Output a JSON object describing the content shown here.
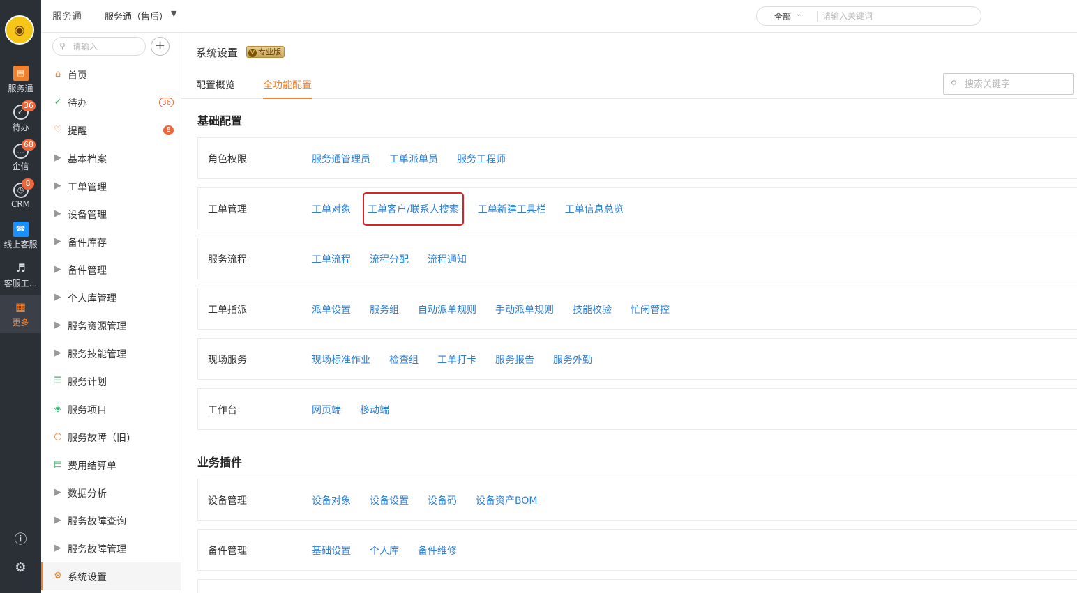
{
  "rail": {
    "items": [
      {
        "label": "服务通",
        "icon": "service-app-icon",
        "badge": ""
      },
      {
        "label": "待办",
        "icon": "check-circle-icon",
        "badge": "36"
      },
      {
        "label": "企信",
        "icon": "chat-bubble-icon",
        "badge": "68"
      },
      {
        "label": "CRM",
        "icon": "clock-icon",
        "badge": "8"
      },
      {
        "label": "线上客服",
        "icon": "headset-icon",
        "badge": ""
      },
      {
        "label": "客服工...",
        "icon": "headphones-icon",
        "badge": ""
      },
      {
        "label": "更多",
        "icon": "grid-icon",
        "badge": ""
      }
    ]
  },
  "topbar": {
    "app_name": "服务通",
    "app_select": "服务通（售后）",
    "search_scope": "全部",
    "search_placeholder": "请输入关键词"
  },
  "sidebar": {
    "search_placeholder": "请输入",
    "items": [
      {
        "label": "首页",
        "icon": "home-icon",
        "badge": ""
      },
      {
        "label": "待办",
        "icon": "check-circle-icon",
        "badge": "36"
      },
      {
        "label": "提醒",
        "icon": "bell-icon",
        "badge": "8"
      },
      {
        "label": "基本档案",
        "icon": "caret-right-icon",
        "badge": ""
      },
      {
        "label": "工单管理",
        "icon": "caret-right-icon",
        "badge": ""
      },
      {
        "label": "设备管理",
        "icon": "caret-right-icon",
        "badge": ""
      },
      {
        "label": "备件库存",
        "icon": "caret-right-icon",
        "badge": ""
      },
      {
        "label": "备件管理",
        "icon": "caret-right-icon",
        "badge": ""
      },
      {
        "label": "个人库管理",
        "icon": "caret-right-icon",
        "badge": ""
      },
      {
        "label": "服务资源管理",
        "icon": "caret-right-icon",
        "badge": ""
      },
      {
        "label": "服务技能管理",
        "icon": "caret-right-icon",
        "badge": ""
      },
      {
        "label": "服务计划",
        "icon": "plan-list-icon",
        "badge": ""
      },
      {
        "label": "服务项目",
        "icon": "layers-icon",
        "badge": ""
      },
      {
        "label": "服务故障（旧)",
        "icon": "bulb-icon",
        "badge": ""
      },
      {
        "label": "费用结算单",
        "icon": "invoice-icon",
        "badge": ""
      },
      {
        "label": "数据分析",
        "icon": "caret-right-icon",
        "badge": ""
      },
      {
        "label": "服务故障查询",
        "icon": "caret-right-icon",
        "badge": ""
      },
      {
        "label": "服务故障管理",
        "icon": "caret-right-icon",
        "badge": ""
      },
      {
        "label": "系统设置",
        "icon": "gear-icon",
        "badge": ""
      }
    ]
  },
  "main": {
    "page_title": "系统设置",
    "pro_badge": "专业版",
    "tabs": [
      {
        "label": "配置概览"
      },
      {
        "label": "全功能配置"
      }
    ],
    "search_placeholder": "搜索关键字",
    "sections": [
      {
        "title": "基础配置",
        "rows": [
          {
            "label": "角色权限",
            "links": [
              "服务通管理员",
              "工单派单员",
              "服务工程师"
            ]
          },
          {
            "label": "工单管理",
            "links": [
              "工单对象",
              "工单客户/联系人搜索",
              "工单新建工具栏",
              "工单信息总览"
            ]
          },
          {
            "label": "服务流程",
            "links": [
              "工单流程",
              "流程分配",
              "流程通知"
            ]
          },
          {
            "label": "工单指派",
            "links": [
              "派单设置",
              "服务组",
              "自动派单规则",
              "手动派单规则",
              "技能校验",
              "忙闲管控"
            ]
          },
          {
            "label": "现场服务",
            "links": [
              "现场标准作业",
              "检查组",
              "工单打卡",
              "服务报告",
              "服务外勤"
            ]
          },
          {
            "label": "工作台",
            "links": [
              "网页端",
              "移动端"
            ]
          }
        ]
      },
      {
        "title": "业务插件",
        "rows": [
          {
            "label": "设备管理",
            "links": [
              "设备对象",
              "设备设置",
              "设备码",
              "设备资产BOM"
            ]
          },
          {
            "label": "备件管理",
            "links": [
              "基础设置",
              "个人库",
              "备件维修"
            ]
          }
        ]
      }
    ]
  },
  "colors": {
    "accent": "#f0812e",
    "link": "#2d7fd8",
    "badge": "#f0663b",
    "highlight_border": "#e02020",
    "rail_bg": "#2b2f36"
  }
}
